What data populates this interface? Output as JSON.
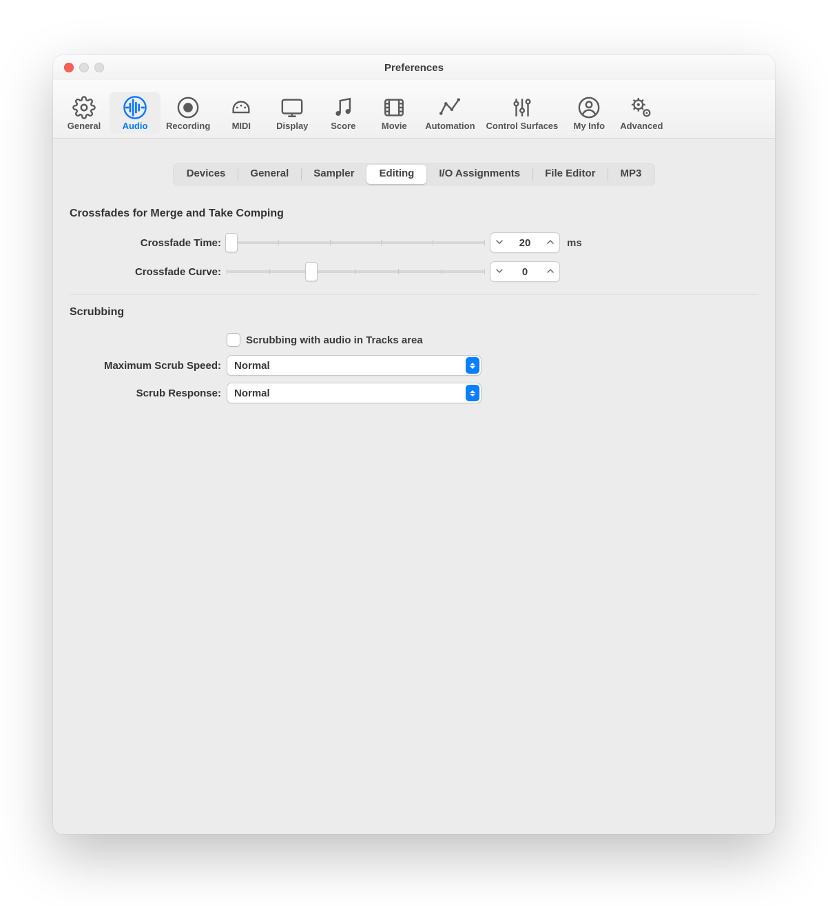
{
  "window": {
    "title": "Preferences"
  },
  "toolbar": {
    "items": [
      {
        "id": "general",
        "label": "General"
      },
      {
        "id": "audio",
        "label": "Audio"
      },
      {
        "id": "recording",
        "label": "Recording"
      },
      {
        "id": "midi",
        "label": "MIDI"
      },
      {
        "id": "display",
        "label": "Display"
      },
      {
        "id": "score",
        "label": "Score"
      },
      {
        "id": "movie",
        "label": "Movie"
      },
      {
        "id": "automation",
        "label": "Automation"
      },
      {
        "id": "control-surfaces",
        "label": "Control Surfaces"
      },
      {
        "id": "my-info",
        "label": "My Info"
      },
      {
        "id": "advanced",
        "label": "Advanced"
      }
    ],
    "selected": "audio"
  },
  "subtabs": {
    "items": [
      {
        "id": "devices",
        "label": "Devices"
      },
      {
        "id": "general",
        "label": "General"
      },
      {
        "id": "sampler",
        "label": "Sampler"
      },
      {
        "id": "editing",
        "label": "Editing"
      },
      {
        "id": "io-assignments",
        "label": "I/O Assignments"
      },
      {
        "id": "file-editor",
        "label": "File Editor"
      },
      {
        "id": "mp3",
        "label": "MP3"
      }
    ],
    "selected": "editing"
  },
  "editing": {
    "crossfades": {
      "heading": "Crossfades for Merge and Take Comping",
      "time_label": "Crossfade Time:",
      "time_value": "20",
      "time_unit": "ms",
      "time_slider_percent": 2,
      "curve_label": "Crossfade Curve:",
      "curve_value": "0",
      "curve_slider_percent": 33
    },
    "scrubbing": {
      "heading": "Scrubbing",
      "checkbox_label": "Scrubbing with audio in Tracks area",
      "checkbox_checked": false,
      "max_speed_label": "Maximum Scrub Speed:",
      "max_speed_value": "Normal",
      "response_label": "Scrub Response:",
      "response_value": "Normal"
    }
  }
}
